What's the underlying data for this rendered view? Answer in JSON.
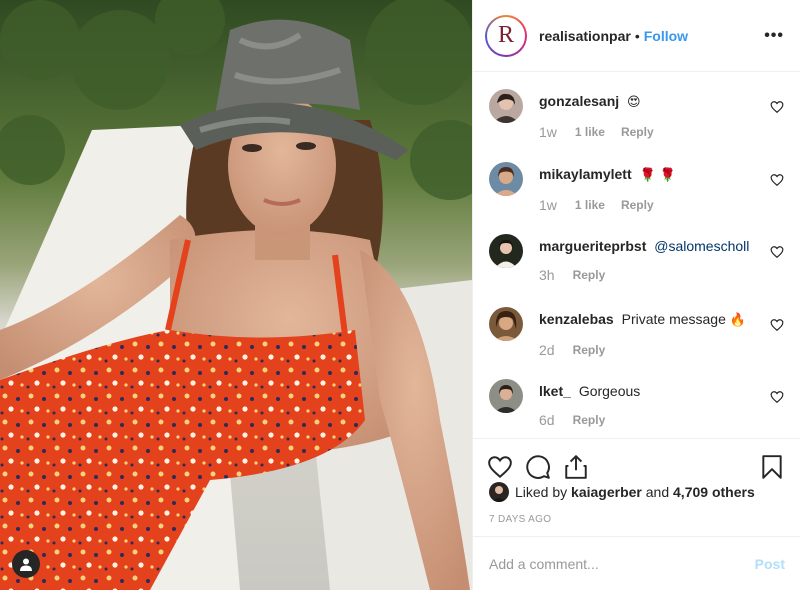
{
  "post": {
    "account": "realisationpar",
    "logo_letter": "R",
    "separator": "•",
    "follow_label": "Follow",
    "more_label": "•••"
  },
  "comments": [
    {
      "user": "gonzalesanj",
      "text": "",
      "emoji": "😍",
      "time": "1w",
      "likes": "1 like",
      "reply": "Reply"
    },
    {
      "user": "mikaylamylett",
      "text": "",
      "emoji": "🌹 🌹",
      "time": "1w",
      "likes": "1 like",
      "reply": "Reply"
    },
    {
      "user": "margueriteprbst",
      "text": "",
      "mention": "@salomescholl",
      "time": "3h",
      "reply": "Reply"
    },
    {
      "user": "kenzalebas",
      "text": "Private message",
      "emoji": "🔥",
      "time": "2d",
      "reply": "Reply"
    },
    {
      "user": "lket_",
      "text": "Gorgeous",
      "time": "6d",
      "reply": "Reply"
    }
  ],
  "likes": {
    "prefix": "Liked by",
    "user": "kaiagerber",
    "middle": "and",
    "others": "4,709 others"
  },
  "timestamp": "7 days ago",
  "composer": {
    "placeholder": "Add a comment...",
    "post_label": "Post"
  },
  "colors": {
    "link_blue": "#3897f0",
    "post_disabled": "#b2dffc",
    "secondary_text": "#999999"
  },
  "icons": [
    "heart-icon",
    "comment-icon",
    "share-icon",
    "bookmark-icon",
    "user-tag-icon",
    "more-icon"
  ]
}
